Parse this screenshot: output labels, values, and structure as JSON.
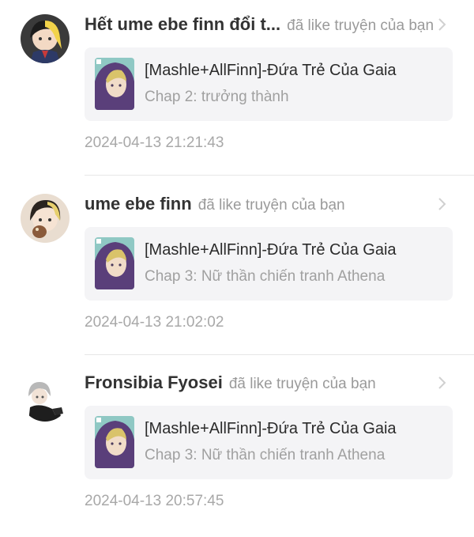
{
  "notifications": [
    {
      "user": "Hết ume ebe finn đổi t...",
      "action": "đã like truyện của bạn",
      "story_title": "[Mashle+AllFinn]-Đứa Trẻ Của Gaia",
      "chapter": "Chap 2: trưởng thành",
      "timestamp": "2024-04-13 21:21:43",
      "avatar_icon": "user-avatar-yellow-hair"
    },
    {
      "user": "ume ebe finn",
      "action": "đã like truyện của bạn",
      "story_title": "[Mashle+AllFinn]-Đứa Trẻ Của Gaia",
      "chapter": "Chap 3: Nữ thần chiến tranh Athena",
      "timestamp": "2024-04-13 21:02:02",
      "avatar_icon": "user-avatar-dark-hair"
    },
    {
      "user": "Fronsibia Fyosei",
      "action": "đã like truyện của bạn",
      "story_title": "[Mashle+AllFinn]-Đứa Trẻ Của Gaia",
      "chapter": "Chap 3: Nữ thần chiến tranh Athena",
      "timestamp": "2024-04-13 20:57:45",
      "avatar_icon": "user-avatar-silver-hair"
    }
  ],
  "colors": {
    "card_background": "#f4f4f6",
    "muted_text": "#a0a0a0",
    "name_text": "#333333"
  }
}
